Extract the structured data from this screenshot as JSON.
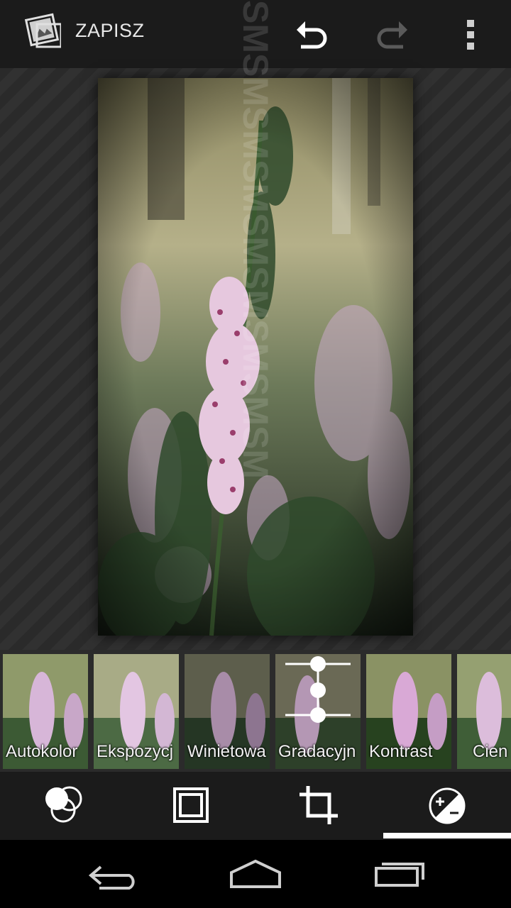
{
  "toolbar": {
    "save_label": "ZAPISZ",
    "icons": [
      "gallery-icon",
      "undo-icon",
      "redo-icon",
      "overflow-menu-icon"
    ]
  },
  "photo": {
    "subject": "heather-flowers"
  },
  "filters": [
    {
      "label": "Autokolor"
    },
    {
      "label": "Ekspozycj"
    },
    {
      "label": "Winietowa"
    },
    {
      "label": "Gradacyjn"
    },
    {
      "label": "Kontrast"
    },
    {
      "label": "Cien"
    }
  ],
  "tabs": [
    {
      "icon": "filters-icon"
    },
    {
      "icon": "frames-icon"
    },
    {
      "icon": "crop-icon"
    },
    {
      "icon": "exposure-icon",
      "selected": true
    }
  ],
  "navbar": {
    "icons": [
      "back-icon",
      "home-icon",
      "recents-icon"
    ]
  },
  "watermark": "SMSMSMSMSMSMSMSMSM",
  "colors": {
    "toolbar": "#1b1b1b",
    "indicator": "#ffffff",
    "canvas": "#2a2a2a"
  }
}
